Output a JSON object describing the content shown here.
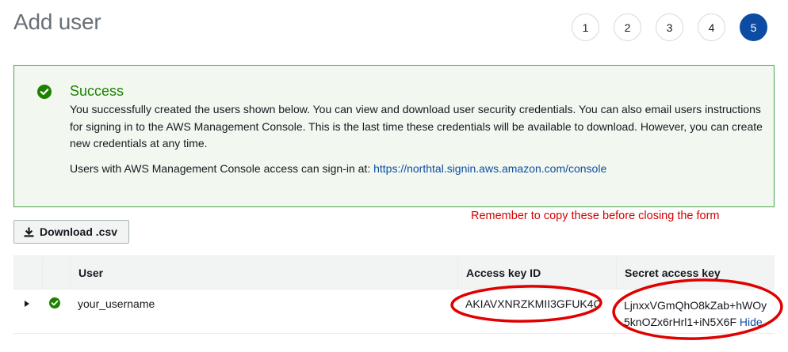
{
  "header": {
    "title": "Add user"
  },
  "steps": [
    "1",
    "2",
    "3",
    "4",
    "5"
  ],
  "alert": {
    "title": "Success",
    "body": "You successfully created the users shown below. You can view and download user security credentials. You can also email users instructions for signing in to the AWS Management Console. This is the last time these credentials will be available to download. However, you can create new credentials at any time.",
    "signin_prefix": "Users with AWS Management Console access can sign-in at: ",
    "signin_url": "https://northtal.signin.aws.amazon.com/console"
  },
  "annotation": {
    "reminder": "Remember to copy these before closing the form",
    "color": "#e00000"
  },
  "toolbar": {
    "download_label": "Download .csv"
  },
  "table": {
    "headers": {
      "user": "User",
      "access_key": "Access key ID",
      "secret_key": "Secret access key"
    },
    "rows": [
      {
        "user": "your_username",
        "access_key": "AKIAVXNRZKMII3GFUK4C",
        "secret_line1": "LjnxxVGmQhO8kZab+hWOy",
        "secret_line2": "5knOZx6rHrl1+iN5X6F",
        "hide_label": "Hide"
      }
    ]
  },
  "colors": {
    "accent": "#0d4ca3",
    "success": "#1d8102",
    "alert_bg": "#f2f8f0"
  }
}
